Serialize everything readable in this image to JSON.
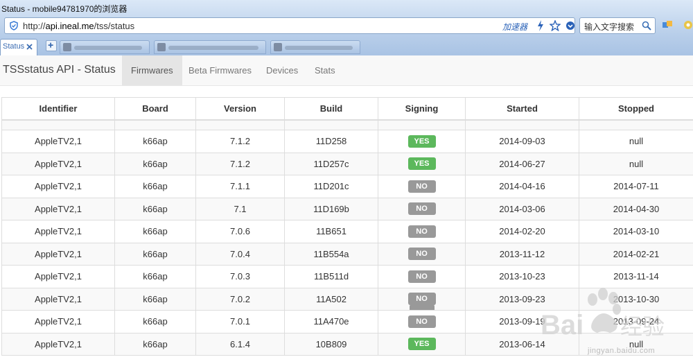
{
  "browser": {
    "window_title": "Status - mobile94781970的浏览器",
    "url_prefix": "http://",
    "url_domain": "api.ineal.me",
    "url_path": "/tss/status",
    "accelerator_label": "加速器",
    "search_placeholder": "输入文字搜索",
    "active_tab_label": "Status",
    "colors": {
      "chrome": "#b9cfea",
      "accent": "#2a62b8"
    }
  },
  "navbar": {
    "brand": "TSSstatus API - Status",
    "items": [
      {
        "label": "Firmwares",
        "active": true
      },
      {
        "label": "Beta Firmwares",
        "active": false
      },
      {
        "label": "Devices",
        "active": false
      },
      {
        "label": "Stats",
        "active": false
      }
    ]
  },
  "table": {
    "columns": [
      "Identifier",
      "Board",
      "Version",
      "Build",
      "Signing",
      "Started",
      "Stopped"
    ],
    "rows": [
      {
        "identifier": "AppleTV2,1",
        "board": "k66ap",
        "version": "7.1.2",
        "build": "11D258",
        "signing": "YES",
        "started": "2014-09-03",
        "stopped": "null"
      },
      {
        "identifier": "AppleTV2,1",
        "board": "k66ap",
        "version": "7.1.2",
        "build": "11D257c",
        "signing": "YES",
        "started": "2014-06-27",
        "stopped": "null"
      },
      {
        "identifier": "AppleTV2,1",
        "board": "k66ap",
        "version": "7.1.1",
        "build": "11D201c",
        "signing": "NO",
        "started": "2014-04-16",
        "stopped": "2014-07-11"
      },
      {
        "identifier": "AppleTV2,1",
        "board": "k66ap",
        "version": "7.1",
        "build": "11D169b",
        "signing": "NO",
        "started": "2014-03-06",
        "stopped": "2014-04-30"
      },
      {
        "identifier": "AppleTV2,1",
        "board": "k66ap",
        "version": "7.0.6",
        "build": "11B651",
        "signing": "NO",
        "started": "2014-02-20",
        "stopped": "2014-03-10"
      },
      {
        "identifier": "AppleTV2,1",
        "board": "k66ap",
        "version": "7.0.4",
        "build": "11B554a",
        "signing": "NO",
        "started": "2013-11-12",
        "stopped": "2014-02-21"
      },
      {
        "identifier": "AppleTV2,1",
        "board": "k66ap",
        "version": "7.0.3",
        "build": "11B511d",
        "signing": "NO",
        "started": "2013-10-23",
        "stopped": "2013-11-14"
      },
      {
        "identifier": "AppleTV2,1",
        "board": "k66ap",
        "version": "7.0.2",
        "build": "11A502",
        "signing": "NO",
        "started": "2013-09-23",
        "stopped": "2013-10-30"
      },
      {
        "identifier": "AppleTV2,1",
        "board": "k66ap",
        "version": "7.0.1",
        "build": "11A470e",
        "signing": "NO",
        "started": "2013-09-19",
        "stopped": "2013-09-24"
      },
      {
        "identifier": "AppleTV2,1",
        "board": "k66ap",
        "version": "6.1.4",
        "build": "10B809",
        "signing": "YES",
        "started": "2013-06-14",
        "stopped": "null"
      }
    ],
    "signing_colors": {
      "YES": "#5cb85c",
      "NO": "#999999"
    }
  },
  "watermark": {
    "brand": "Bai 经验",
    "url": "jingyan.baidu.com"
  }
}
